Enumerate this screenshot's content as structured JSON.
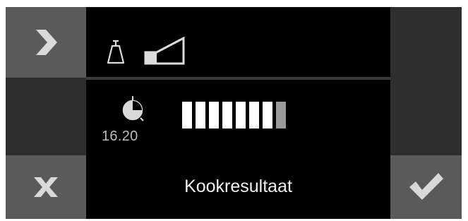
{
  "left_column": {
    "next_icon": "chevron-right-icon",
    "cancel_icon": "close-x-icon"
  },
  "right_column": {
    "confirm_icon": "checkmark-icon"
  },
  "settings_row": {
    "weight_icon": "weight-icon",
    "level_icon": "level-wedge-icon"
  },
  "timer_row": {
    "timer_icon": "timer-icon",
    "time_value": "16.20",
    "progress": {
      "filled_segments": 7,
      "dim_segments": 1,
      "fraction": 0.875
    }
  },
  "footer": {
    "label": "Kookresultaat"
  },
  "colors": {
    "screen_bg": "#000000",
    "button_bg": "#5a5a5a",
    "blank_bg": "#2e2e2e",
    "icon_light": "#dcdcdc"
  }
}
